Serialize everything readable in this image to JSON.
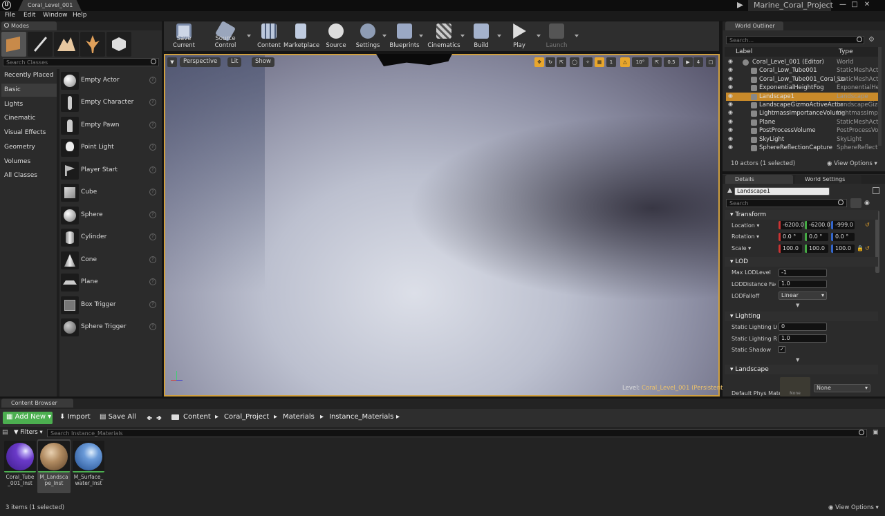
{
  "window": {
    "doc_tab": "Coral_Level_001",
    "project": "Marine_Coral_Project"
  },
  "menu": [
    "File",
    "Edit",
    "Window",
    "Help"
  ],
  "modes": {
    "tab": "Modes",
    "search_placeholder": "Search Classes",
    "categories": [
      "Recently Placed",
      "Basic",
      "Lights",
      "Cinematic",
      "Visual Effects",
      "Geometry",
      "Volumes",
      "All Classes"
    ],
    "active_category": "Basic",
    "items": [
      "Empty Actor",
      "Empty Character",
      "Empty Pawn",
      "Point Light",
      "Player Start",
      "Cube",
      "Sphere",
      "Cylinder",
      "Cone",
      "Plane",
      "Box Trigger",
      "Sphere Trigger"
    ]
  },
  "toolbar": [
    "Save Current",
    "Source Control",
    "Content",
    "Marketplace",
    "Source",
    "Settings",
    "Blueprints",
    "Cinematics",
    "Build",
    "Play",
    "Launch"
  ],
  "viewport": {
    "perspective": "Perspective",
    "lit": "Lit",
    "show": "Show",
    "grid_num": "1",
    "angle": "10°",
    "scale": "0.5",
    "cam_speed": "4",
    "level_label": "Level:",
    "level_name": "Coral_Level_001 (Persistent)"
  },
  "outliner": {
    "tab": "World Outliner",
    "search_placeholder": "Search...",
    "col_label": "Label",
    "col_type": "Type",
    "rows": [
      {
        "name": "Coral_Level_001 (Editor)",
        "type": "World"
      },
      {
        "name": "Coral_Low_Tube001",
        "type": "StaticMeshActo"
      },
      {
        "name": "Coral_Low_Tube001_Coral_Lo",
        "type": "StaticMeshActo"
      },
      {
        "name": "ExponentialHeightFog",
        "type": "ExponentialHeig"
      },
      {
        "name": "Landscape1",
        "type": "Landscape"
      },
      {
        "name": "LandscapeGizmoActiveActor",
        "type": "LandscapeGizm"
      },
      {
        "name": "LightmassImportanceVolume",
        "type": "LightmassImpo"
      },
      {
        "name": "Plane",
        "type": "StaticMeshActo"
      },
      {
        "name": "PostProcessVolume",
        "type": "PostProcessVol"
      },
      {
        "name": "SkyLight",
        "type": "SkyLight"
      },
      {
        "name": "SphereReflectionCapture",
        "type": "SphereReflectio"
      }
    ],
    "status": "10 actors (1 selected)",
    "view_options": "View Options"
  },
  "details": {
    "tab": "Details",
    "tab2": "World Settings",
    "object_name": "Landscape1",
    "search_placeholder": "Search",
    "transform": {
      "header": "Transform",
      "location_label": "Location",
      "location": [
        "-6200.0",
        "-6200.0",
        "-999.0"
      ],
      "rotation_label": "Rotation",
      "rotation": [
        "0.0 °",
        "0.0 °",
        "0.0 °"
      ],
      "scale_label": "Scale",
      "scale": [
        "100.0",
        "100.0",
        "100.0"
      ]
    },
    "lod": {
      "header": "LOD",
      "max_label": "Max LODLevel",
      "max": "-1",
      "dist_label": "LODDistance Facto",
      "dist": "1.0",
      "falloff_label": "LODFalloff",
      "falloff": "Linear"
    },
    "lighting": {
      "header": "Lighting",
      "lod_label": "Static Lighting LOD",
      "lod": "0",
      "res_label": "Static Lighting Res",
      "res": "1.0",
      "shadow_label": "Static Shadow"
    },
    "landscape": {
      "header": "Landscape",
      "phys_label": "Default Phys Mate",
      "phys_thumb": "None",
      "phys_value": "None"
    }
  },
  "content_browser": {
    "tab": "Content Browser",
    "add_new": "Add New",
    "import": "Import",
    "save_all": "Save All",
    "path": [
      "Content",
      "Coral_Project",
      "Materials",
      "Instance_Materials"
    ],
    "filters": "Filters",
    "search_placeholder": "Search Instance_Materials",
    "assets": [
      {
        "name": "Coral_Tube_001_Inst"
      },
      {
        "name": "M_Landscape_Inst"
      },
      {
        "name": "M_Surface_water_Inst"
      }
    ],
    "status": "3 items (1 selected)",
    "view_options": "View Options"
  },
  "colors": {
    "accent": "#e8a62c",
    "selected_row": "#c88a2a",
    "add_new": "#4caf50"
  }
}
